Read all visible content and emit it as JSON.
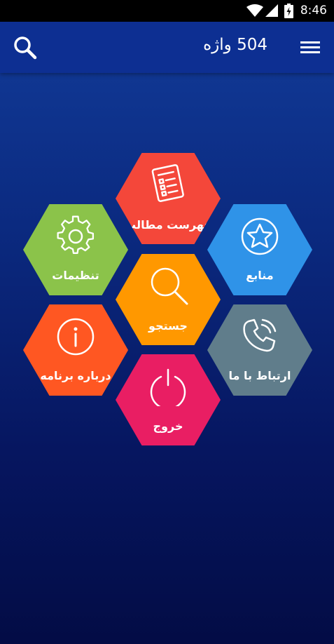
{
  "status_bar": {
    "time": "8:46"
  },
  "app_bar": {
    "title": "504 واژه"
  },
  "menu": {
    "table_of_contents": {
      "label": "فهرست مطالب",
      "color": "#f4473a"
    },
    "resources": {
      "label": "منابع",
      "color": "#2f93e8"
    },
    "settings": {
      "label": "تنظیمات",
      "color": "#8bc34a"
    },
    "search": {
      "label": "جستجو",
      "color": "#ff9800"
    },
    "about": {
      "label": "درباره برنامه",
      "color": "#ff5722"
    },
    "contact": {
      "label": "ارتباط با ما",
      "color": "#607d8b"
    },
    "exit": {
      "label": "خروج",
      "color": "#e91e63"
    }
  },
  "icons": {
    "statusbar": [
      "wifi-icon",
      "signal-icon",
      "battery-icon"
    ],
    "appbar": [
      "search-icon",
      "hamburger-menu-icon"
    ],
    "tiles": [
      "list-document-icon",
      "star-circle-icon",
      "gear-icon",
      "magnifier-icon",
      "info-circle-icon",
      "phone-call-icon",
      "power-icon"
    ]
  }
}
